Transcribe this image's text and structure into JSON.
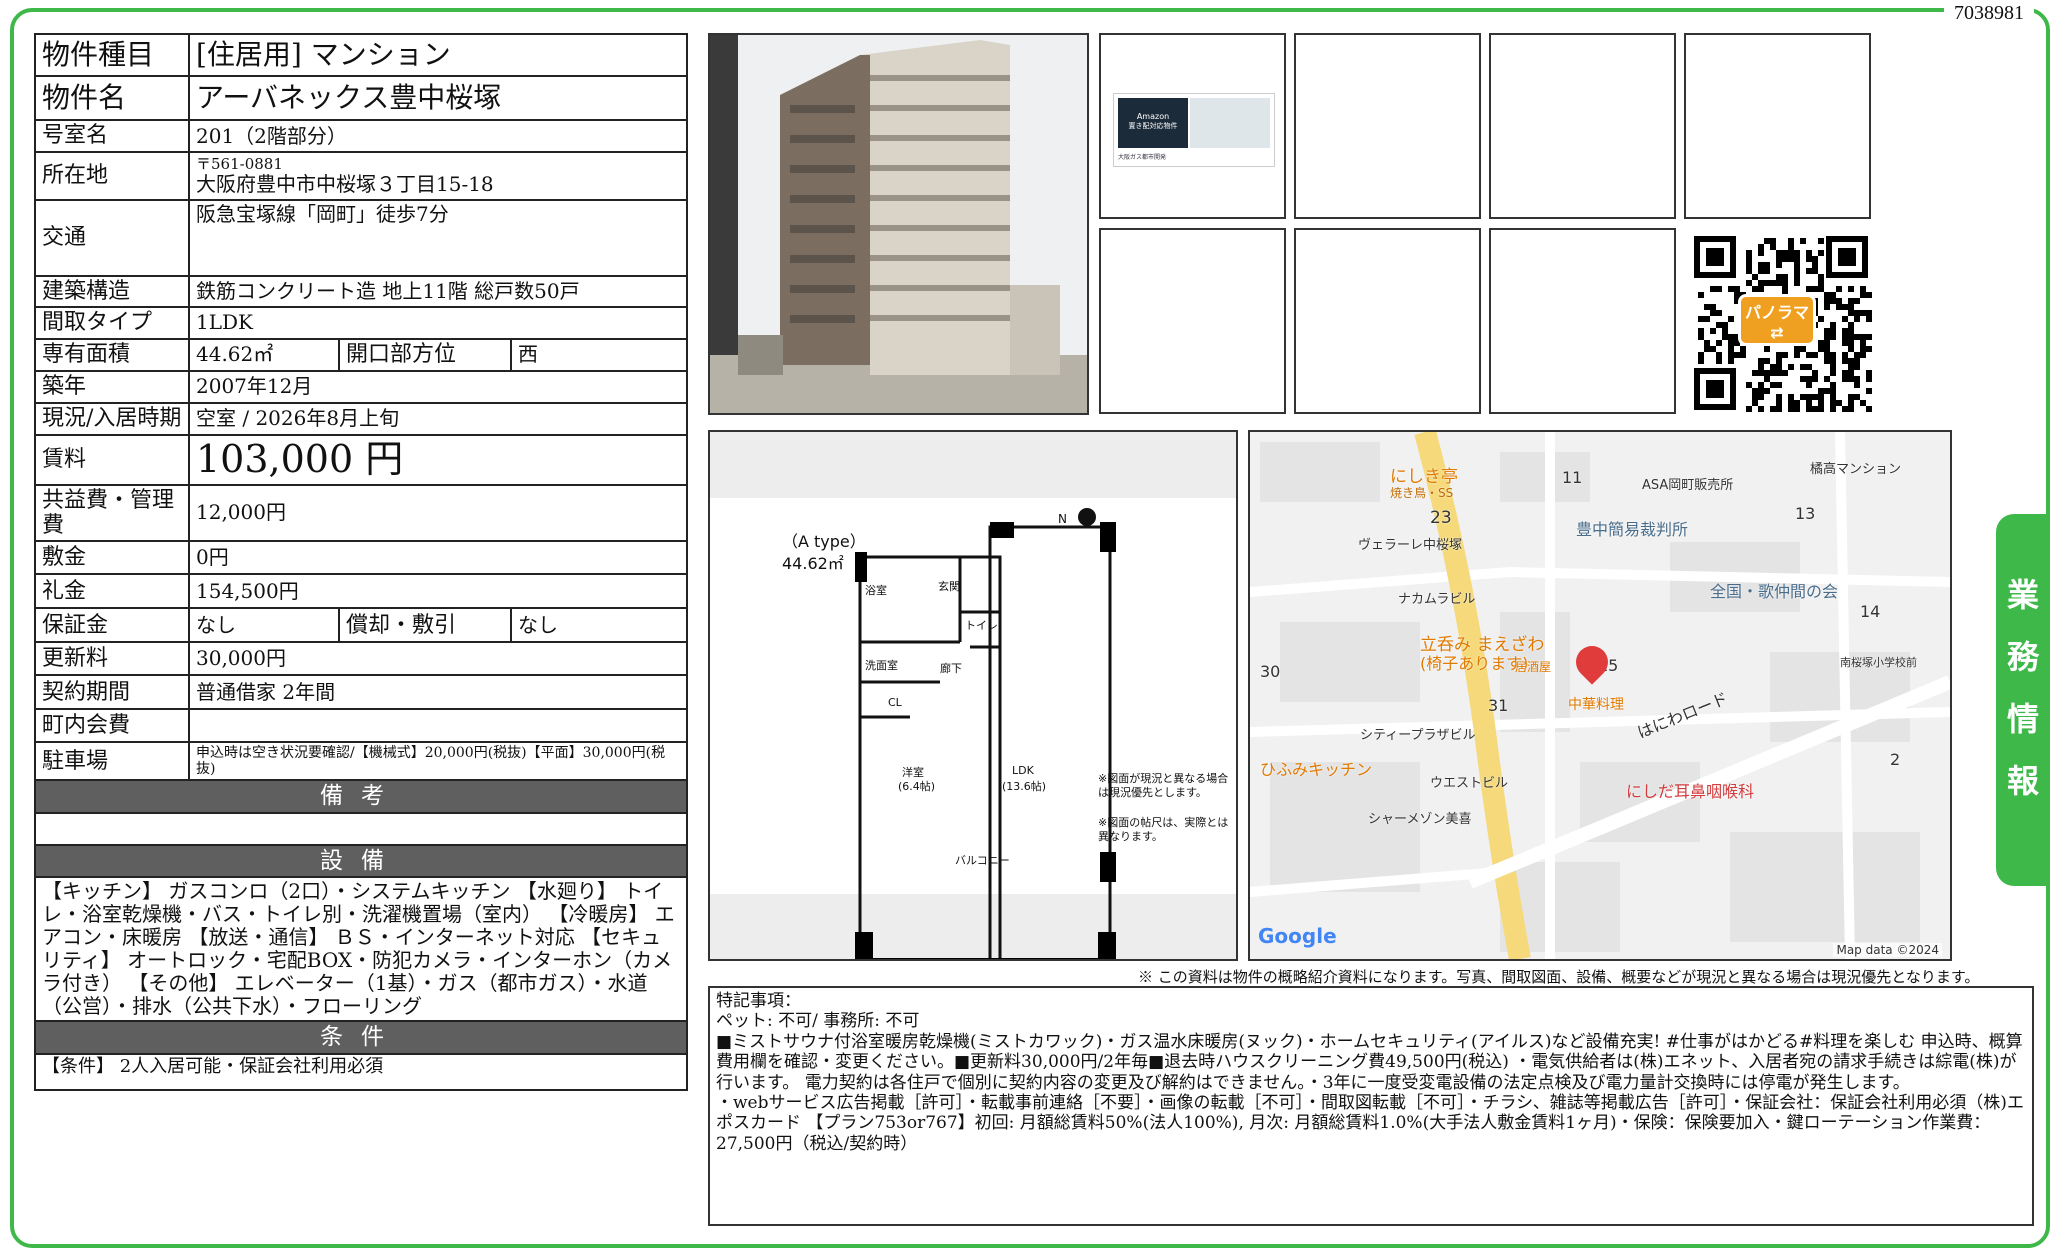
{
  "doc_id": "7038981",
  "spec": {
    "type_label": "物件種目",
    "type_value": "[住居用]  マンション",
    "name_label": "物件名",
    "name_value": "アーバネックス豊中桜塚",
    "room_label": "号室名",
    "room_value": "201（2階部分）",
    "address_label": "所在地",
    "postal": "〒561-0881",
    "address_value": "大阪府豊中市中桜塚３丁目15-18",
    "access_label": "交通",
    "access_value": "阪急宝塚線「岡町」徒歩7分",
    "structure_label": "建築構造",
    "structure_value": "鉄筋コンクリート造  地上11階  総戸数50戸",
    "layout_label": "間取タイプ",
    "layout_value": "1LDK",
    "area_label": "専有面積",
    "area_value": "44.62㎡",
    "direction_label": "開口部方位",
    "direction_value": "西",
    "built_label": "築年",
    "built_value": "2007年12月",
    "status_label": "現況/入居時期",
    "status_value": "空室  /  2026年8月上旬",
    "rent_label": "賃料",
    "rent_value": "103,000 円",
    "fee_label": "共益費・管理費",
    "fee_value": "12,000円",
    "deposit_label": "敷金",
    "deposit_value": "0円",
    "key_money_label": "礼金",
    "key_money_value": "154,500円",
    "guarantee_label": "保証金",
    "guarantee_value": "なし",
    "amort_label": "償却・敷引",
    "amort_value": "なし",
    "renewal_label": "更新料",
    "renewal_value": "30,000円",
    "contract_label": "契約期間",
    "contract_value": "普通借家  2年間",
    "community_label": "町内会費",
    "community_value": "",
    "parking_label": "駐車場",
    "parking_value": "申込時は空き状況要確認/【機械式】20,000円(税抜)【平面】30,000円(税抜)",
    "remarks_header": "備考",
    "equipment_header": "設備",
    "equipment_text": "【キッチン】 ガスコンロ（2口）・システムキッチン 【水廻り】 トイレ・浴室乾燥機・バス・トイレ別・洗濯機置場（室内） 【冷暖房】 エアコン・床暖房 【放送・通信】 ＢＳ・インターネット対応 【セキュリティ】 オートロック・宅配BOX・防犯カメラ・インターホン（カメラ付き） 【その他】 エレベーター（1基）・ガス（都市ガス）・水道（公営）・排水（公共下水）・フローリング",
    "conditions_header": "条件",
    "conditions_text": "【条件】 2人入居可能・保証会社利用必須"
  },
  "thumb_poster": {
    "title": "Amazon",
    "subtitle": "置き配対応物件",
    "footer": "大阪ガス都市開発"
  },
  "qr": {
    "badge": "パノラマ"
  },
  "floorplan": {
    "type_label": "（A type）",
    "area": "44.62㎡",
    "north": "N",
    "rooms": [
      "浴室",
      "玄関",
      "洗面室",
      "トイレ",
      "廊下",
      "CL",
      "洋室",
      "(6.4帖)",
      "LDK",
      "(13.6帖)",
      "バルコニー"
    ],
    "note1": "※図面が現況と異なる場合は現況優先とします。",
    "note2": "※図面の帖尺は、実際とは異なります。"
  },
  "map": {
    "labels": [
      "にしき亭",
      "焼き鳥・SS",
      "11",
      "橘高マンション",
      "ASA岡町販売所",
      "23",
      "13",
      "豊中簡易裁判所",
      "ヴェラーレ中桜塚",
      "全国・歌仲間の会",
      "ナカムラビル",
      "14",
      "立呑み まえざわ",
      "(椅子あります)",
      "居酒屋",
      "15",
      "30",
      "南桜塚小学校前",
      "31",
      "中華料理",
      "はにわロード",
      "シティープラザビル",
      "ひふみキッチン",
      "2",
      "ウエストビル",
      "にしだ耳鼻咽喉科",
      "シャーメゾン美喜"
    ],
    "google": "Google",
    "attribution": "Map data ©2024"
  },
  "notice": "※ この資料は物件の概略紹介資料になります。写真、間取図面、設備、概要などが現況と異なる場合は現況優先となります。",
  "special": {
    "line1": "特記事項：",
    "line2": "ペット: 不可/ 事務所: 不可",
    "line3": "■ミストサウナ付浴室暖房乾燥機(ミストカワック)・ガス温水床暖房(ヌック)・ホームセキュリティ(アイルス)など設備充実! #仕事がはかどる#料理を楽しむ 申込時、概算費用欄を確認・変更ください。■更新料30,000円/2年毎■退去時ハウスクリーニング費49,500円(税込) ・電気供給者は(株)エネット、入居者宛の請求手続きは綜電(株)が行います。 電力契約は各住戸で個別に契約内容の変更及び解約はできません。・3年に一度受変電設備の法定点検及び電力量計交換時には停電が発生します。",
    "line4": "・webサービス広告掲載［許可］・転載事前連絡［不要］・画像の転載［不可］・間取図転載［不可］・チラシ、雑誌等掲載広告［許可］・保証会社：保証会社利用必須（株)エポスカード 【プラン753or767】初回: 月額総賃料50%(法人100%), 月次: 月額総賃料1.0%(大手法人敷金賃料1ヶ月)・保険：保険要加入・鍵ローテーション作業費：27,500円（税込/契約時）"
  },
  "side_tab": [
    "業",
    "務",
    "情",
    "報"
  ],
  "colors": {
    "frame_green": "#3fb84a",
    "section_gray": "#5f5f5f",
    "map_pin": "#e03c3c",
    "map_poi": "#f0a020",
    "map_road": "#f5d97a"
  }
}
